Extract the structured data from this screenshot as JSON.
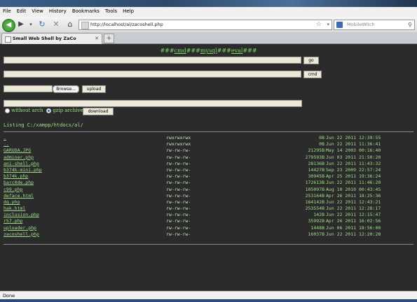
{
  "browser": {
    "menu": [
      "File",
      "Edit",
      "View",
      "History",
      "Bookmarks",
      "Tools",
      "Help"
    ],
    "url": "http://localhost/al/zacoshell.php",
    "search_placeholder": "MobileWitch",
    "tab_title": "Small Web Shell by ZaCo",
    "status": "Done"
  },
  "shell": {
    "links": {
      "sep": "###",
      "cmd": "cmd",
      "mysql": "mysql",
      "eval": "eval"
    },
    "go_label": "go",
    "cmd_label": "cmd",
    "browse_label": "Browse...",
    "upload_label": "upload",
    "without_arch": "without arch",
    "gzip_archive": "gzip archive",
    "download_label": "download",
    "listing": "Listing C:/xampp/htdocs/al/"
  },
  "files": [
    {
      "name": ".",
      "perm": "rwxrwxrwx",
      "size": "0B",
      "date": "Jun 22 2011 12:39:55"
    },
    {
      "name": "..",
      "perm": "rwxrwxrwx",
      "size": "0B",
      "date": "Jun 22 2011 11:36:41"
    },
    {
      "name": "GARUDA.JPG",
      "perm": "rw-rw-rw-",
      "size": "21295B",
      "date": "May 14 2003 00:16:40"
    },
    {
      "name": "adminer.php",
      "perm": "rw-rw-rw-",
      "size": "279593B",
      "date": "Jun 03 2011 21:50:20"
    },
    {
      "name": "ani-shell.php",
      "perm": "rw-rw-rw-",
      "size": "28136B",
      "date": "Jun 22 2011 11:43:32"
    },
    {
      "name": "b374k-mini.php",
      "perm": "rw-rw-rw-",
      "size": "14427B",
      "date": "Sep 23 2009 22:57:24"
    },
    {
      "name": "b374k.php",
      "perm": "rw-rw-rw-",
      "size": "30945B",
      "date": "Apr 25 2011 19:36:24"
    },
    {
      "name": "barc0de.php",
      "perm": "rw-rw-rw-",
      "size": "172613B",
      "date": "Jun 22 2011 11:46:20"
    },
    {
      "name": "c99.php",
      "perm": "rw-rw-rw-",
      "size": "105097B",
      "date": "Aug 10 2010 00:43:45"
    },
    {
      "name": "deface.html",
      "perm": "rw-rw-rw-",
      "size": "253164B",
      "date": "Apr 26 2011 18:25:36"
    },
    {
      "name": "dq.php",
      "perm": "rw-rw-rw-",
      "size": "164142B",
      "date": "Jun 22 2011 12:43:21"
    },
    {
      "name": "hak.html",
      "perm": "rw-rw-rw-",
      "size": "253554B",
      "date": "Jun 22 2011 12:28:17"
    },
    {
      "name": "inclusion.php",
      "perm": "rw-rw-rw-",
      "size": "142B",
      "date": "Jun 22 2011 12:15:47"
    },
    {
      "name": "r57.php",
      "perm": "rw-rw-rw-",
      "size": "35992B",
      "date": "Apr 26 2011 16:02:56"
    },
    {
      "name": "uploader.php",
      "perm": "rw-rw-rw-",
      "size": "1448B",
      "date": "Jun 06 2011 18:56:00"
    },
    {
      "name": "zacoshell.php",
      "perm": "rw-rw-rw-",
      "size": "16037B",
      "date": "Jun 22 2011 12:20:28"
    }
  ]
}
